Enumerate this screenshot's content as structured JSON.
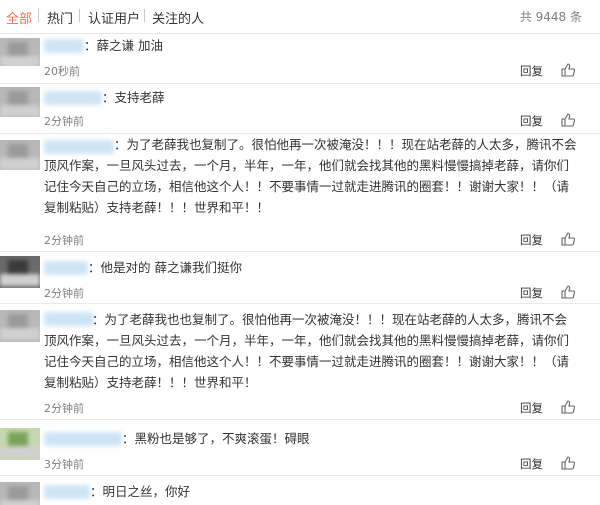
{
  "filters": {
    "tabs": [
      "全部",
      "热门",
      "认证用户",
      "关注的人"
    ],
    "total_text": "共 9448 条"
  },
  "colors": {
    "accent": "#eb7350",
    "muted": "#808080"
  },
  "comments": [
    {
      "text": "：薛之谦 加油",
      "time": "20秒前",
      "reply": "回复",
      "icon": "thumbs-up-icon"
    },
    {
      "text": "：支持老薛",
      "time": "2分钟前",
      "reply": "回复",
      "icon": "thumbs-up-icon"
    },
    {
      "text": "：为了老薛我也复制了。很怕他再一次被淹没！！！现在站老薛的人太多，腾讯不会顶风作案，一旦风头过去，一个月，半年，一年，他们就会找其他的黑料慢慢搞掉老薛，请你们记住今天自己的立场，相信他这个人！！不要事情一过就走进腾讯的圈套！！谢谢大家！！（请复制粘贴）支持老薛！！！世界和平！！",
      "time": "2分钟前",
      "reply": "回复",
      "icon": "thumbs-up-icon"
    },
    {
      "text": "：他是对的 薛之谦我们挺你",
      "time": "2分钟前",
      "reply": "回复",
      "icon": "thumbs-up-icon"
    },
    {
      "text": "：为了老薛我也也复制了。很怕他再一次被淹没！！！现在站老薛的人太多，腾讯不会顶风作案，一旦风头过去，一个月，半年，一年，他们就会找其他的黑料慢慢搞掉老薛，请你们记住今天自己的立场，相信他这个人！！不要事情一过就走进腾讯的圈套！！谢谢大家！！（请复制粘贴）支持老薛！！！世界和平！",
      "time": "2分钟前",
      "reply": "回复",
      "icon": "thumbs-up-icon"
    },
    {
      "text": "：黑粉也是够了，不爽滚蛋！碍眼",
      "time": "3分钟前",
      "reply": "回复",
      "icon": "thumbs-up-icon"
    },
    {
      "text": "：明日之丝，你好",
      "time": "",
      "reply": "",
      "icon": ""
    }
  ]
}
